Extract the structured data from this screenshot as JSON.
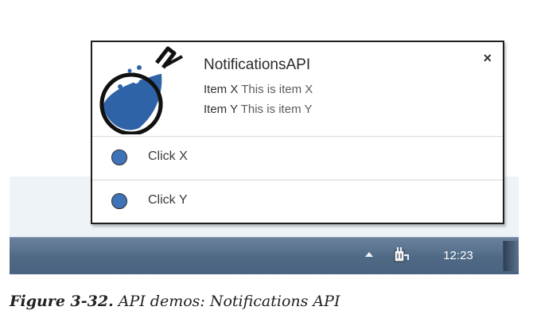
{
  "notification": {
    "app_name": "NotificationsAPI",
    "items": [
      {
        "title": "Item X",
        "message": "This is item X"
      },
      {
        "title": "Item Y",
        "message": "This is item Y"
      }
    ],
    "actions": [
      {
        "label": "Click X"
      },
      {
        "label": "Click Y"
      }
    ],
    "close_glyph": "×",
    "logo_icon": "flask-icon",
    "accent_color": "#3f73b8"
  },
  "taskbar": {
    "clock": "12:23",
    "tray_icons": [
      "chevron-up-icon",
      "power-plug-icon"
    ]
  },
  "caption": {
    "figure_number": "Figure 3-32.",
    "text": "API demos: Notifications API"
  }
}
